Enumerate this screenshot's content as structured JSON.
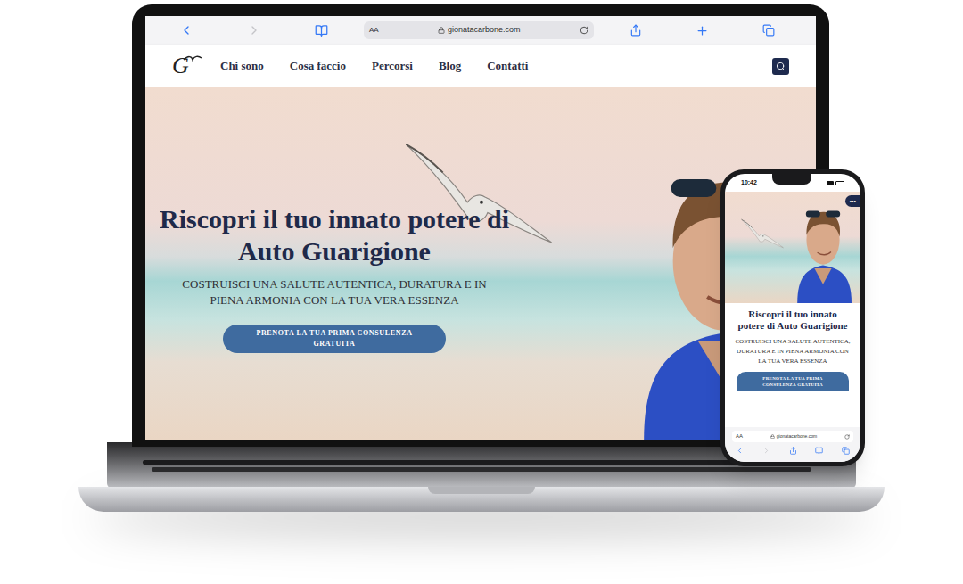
{
  "browser": {
    "reader": "AA",
    "url": "gionatacarbone.com"
  },
  "nav": {
    "logo": "G",
    "items": [
      {
        "label": "Chi sono"
      },
      {
        "label": "Cosa faccio"
      },
      {
        "label": "Percorsi"
      },
      {
        "label": "Blog"
      },
      {
        "label": "Contatti"
      }
    ]
  },
  "hero": {
    "title": "Riscopri il tuo innato potere di Auto Guarigione",
    "subtitle": "COSTRUISCI UNA SALUTE AUTENTICA, DURATURA E IN PIENA ARMONIA CON LA TUA VERA ESSENZA",
    "button": "PRENOTA LA TUA PRIMA CONSULENZA GRATUITA"
  },
  "phone": {
    "time": "10:42",
    "menu": "•••",
    "title": "Riscopri il tuo innato potere di Auto Guarigione",
    "subtitle": "COSTRUISCI UNA SALUTE AUTENTICA, DURATURA E IN PIENA ARMONIA CON LA TUA VERA ESSENZA",
    "button": "PRENOTA LA TUA PRIMA CONSULENZA GRATUITA",
    "reader": "AA",
    "url": "gionatacarbone.com"
  }
}
